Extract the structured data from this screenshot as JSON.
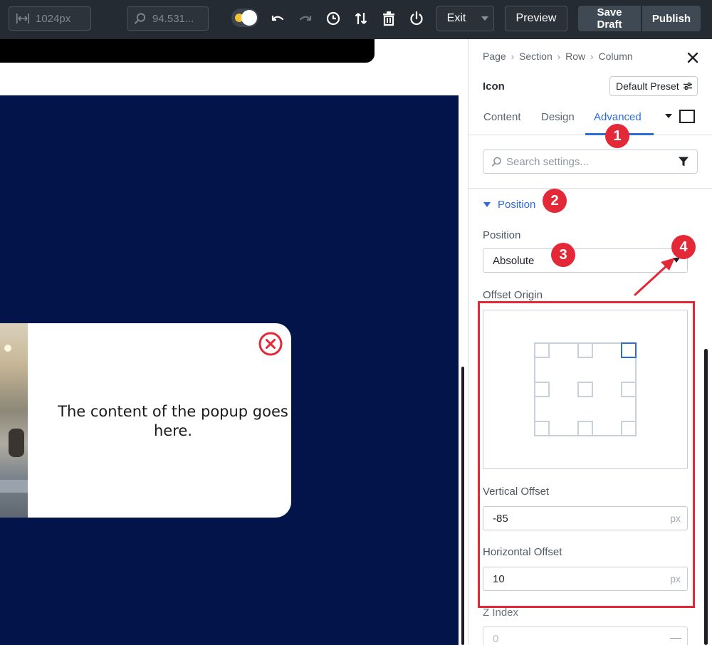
{
  "toolbar": {
    "width_value": "1024px",
    "zoom_value": "94.531...",
    "exit_label": "Exit",
    "preview_label": "Preview",
    "save_draft_label": "Save Draft",
    "publish_label": "Publish"
  },
  "canvas": {
    "popup_text": "The content of the popup goes here."
  },
  "panel": {
    "breadcrumb": [
      "Page",
      "Section",
      "Row",
      "Column"
    ],
    "module_name": "Icon",
    "preset_label": "Default Preset",
    "tabs": [
      "Content",
      "Design",
      "Advanced"
    ],
    "active_tab": "Advanced",
    "search_placeholder": "Search settings...",
    "section_title": "Position",
    "position_label": "Position",
    "position_value": "Absolute",
    "offset_origin_label": "Offset Origin",
    "offset_origin_active": "top-right",
    "vertical_offset_label": "Vertical Offset",
    "vertical_offset_value": "-85",
    "horizontal_offset_label": "Horizontal Offset",
    "horizontal_offset_value": "10",
    "unit": "px",
    "z_index_label": "Z Index",
    "z_index_value": "0"
  },
  "annotations": {
    "badges": [
      "1",
      "2",
      "3",
      "4"
    ]
  },
  "colors": {
    "accent": "#2b6cdd",
    "annotation_red": "#e32838",
    "canvas_navy": "#02144a",
    "toolbar_bg": "#242b33"
  },
  "icons": [
    "responsive-width-icon",
    "zoom-icon",
    "undo-icon",
    "redo-icon",
    "history-icon",
    "sort-icon",
    "trash-icon",
    "power-icon",
    "close-icon",
    "sliders-icon",
    "search-icon",
    "filter-icon"
  ]
}
